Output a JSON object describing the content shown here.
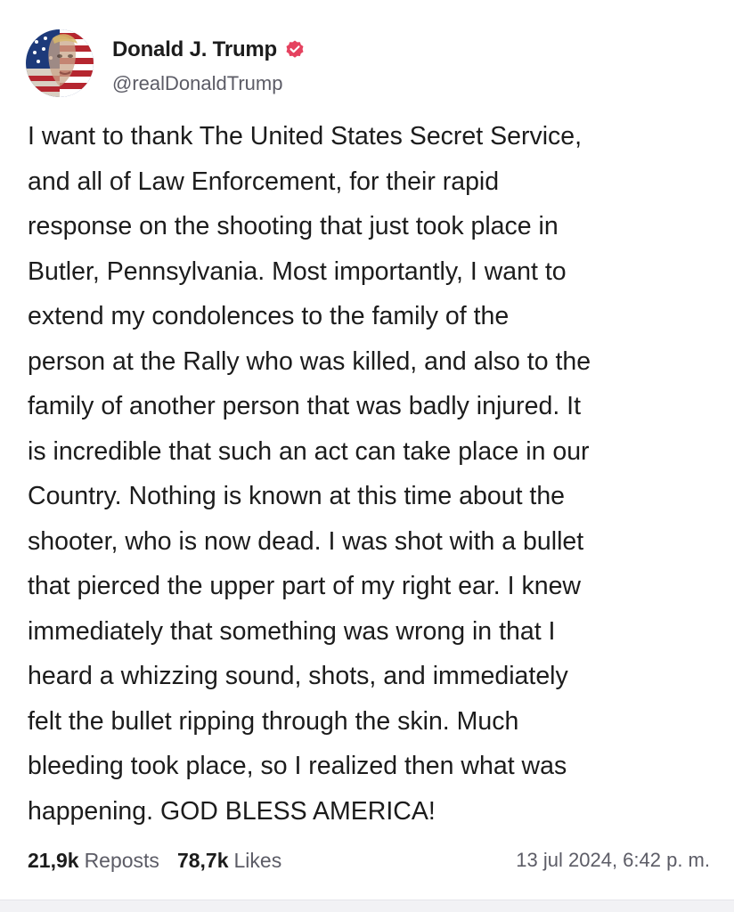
{
  "post": {
    "author": {
      "display_name": "Donald J. Trump",
      "handle": "@realDonaldTrump",
      "verified": true,
      "badge_color": "#e5425f"
    },
    "lines": [
      "I want to thank The United States Secret Service,",
      "and all of Law Enforcement, for their rapid",
      "response on the shooting that just took place in",
      "Butler, Pennsylvania. Most importantly, I want to",
      "extend my condolences to the family of the",
      "person at the Rally who was killed, and also to the",
      "family of another person that was badly injured. It",
      "is incredible that such an act can take place in our",
      "Country. Nothing is known at this time about the",
      "shooter, who is now dead. I was shot with a bullet",
      "that pierced the upper part of my right ear. I knew",
      "immediately that something was wrong in that I",
      "heard a whizzing sound, shots, and immediately",
      "felt the bullet ripping through the skin. Much",
      "bleeding took place, so I realized then what was",
      "happening. GOD BLESS AMERICA!"
    ],
    "stats": {
      "reposts_count": "21,9k",
      "reposts_label": "Reposts",
      "likes_count": "78,7k",
      "likes_label": "Likes"
    },
    "timestamp": "13 jul 2024, 6:42 p. m."
  },
  "icons": {
    "avatar": "avatar-flag-portrait",
    "verified": "verified-badge-icon"
  }
}
